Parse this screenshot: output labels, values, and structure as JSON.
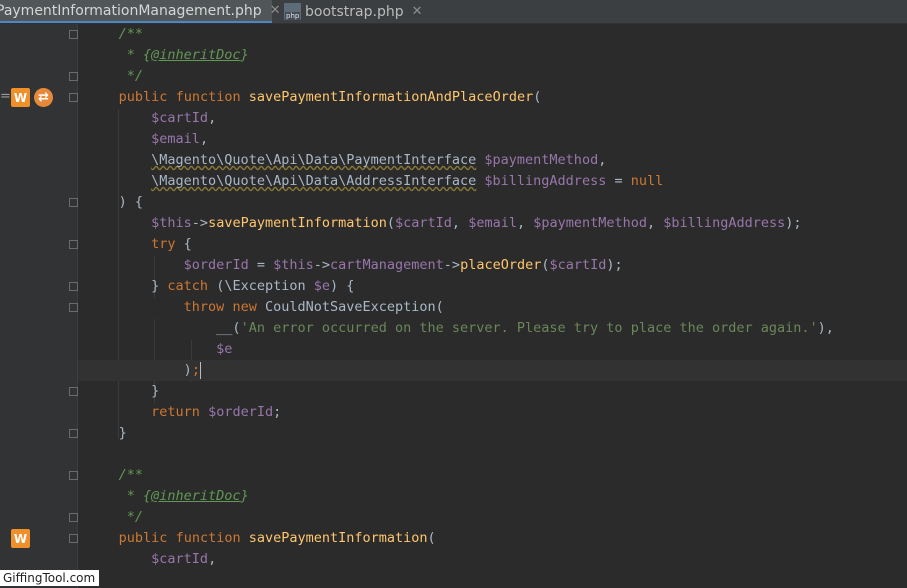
{
  "tabs": [
    {
      "label": "PaymentInformationManagement.php",
      "active": true
    },
    {
      "label": "bootstrap.php",
      "active": false,
      "file_type": "php"
    }
  ],
  "tab_close_glyph": "✕",
  "gutter_icons": {
    "w_label": "W",
    "sync_glyph": "⇄",
    "cut_mark": "="
  },
  "code": {
    "doc1_open": "/**",
    "doc1_star": " * {",
    "doc1_tag": "@inheritDoc",
    "doc1_end": "}",
    "doc1_close": " */",
    "kw_public": "public",
    "kw_function": "function",
    "fn_save_place": "savePaymentInformationAndPlaceOrder",
    "open_paren": "(",
    "var_cartId": "$cartId",
    "var_email": "$email",
    "comma": ",",
    "cls_payment_interface": "\\Magento\\Quote\\Api\\Data\\PaymentInterface",
    "var_paymentMethod": "$paymentMethod",
    "cls_address_interface": "\\Magento\\Quote\\Api\\Data\\AddressInterface",
    "var_billingAddress": "$billingAddress",
    "equals": " = ",
    "kw_null": "null",
    "close_sig": ") {",
    "var_this": "$this",
    "arrow": "->",
    "fn_save_info": "savePaymentInformation",
    "call_args_sep": ", ",
    "close_call": ");",
    "kw_try": "try",
    "brace_open": " {",
    "var_orderId": "$orderId",
    "prop_cartManagement": "cartManagement",
    "fn_placeOrder": "placeOrder",
    "close_try": "} ",
    "kw_catch": "catch",
    "catch_open": " (\\Exception ",
    "var_e": "$e",
    "catch_close": ") {",
    "kw_throw": "throw",
    "kw_new": "new",
    "cls_exception": "CouldNotSaveException",
    "translate_fn": "__(",
    "error_message": "'An error occurred on the server. Please try to place the order again.'",
    "translate_close": "),",
    "close_paren": ")",
    "semicolon": ";",
    "brace_close": "}",
    "kw_return": "return",
    "space": " "
  },
  "watermark": "GiffingTool.com"
}
